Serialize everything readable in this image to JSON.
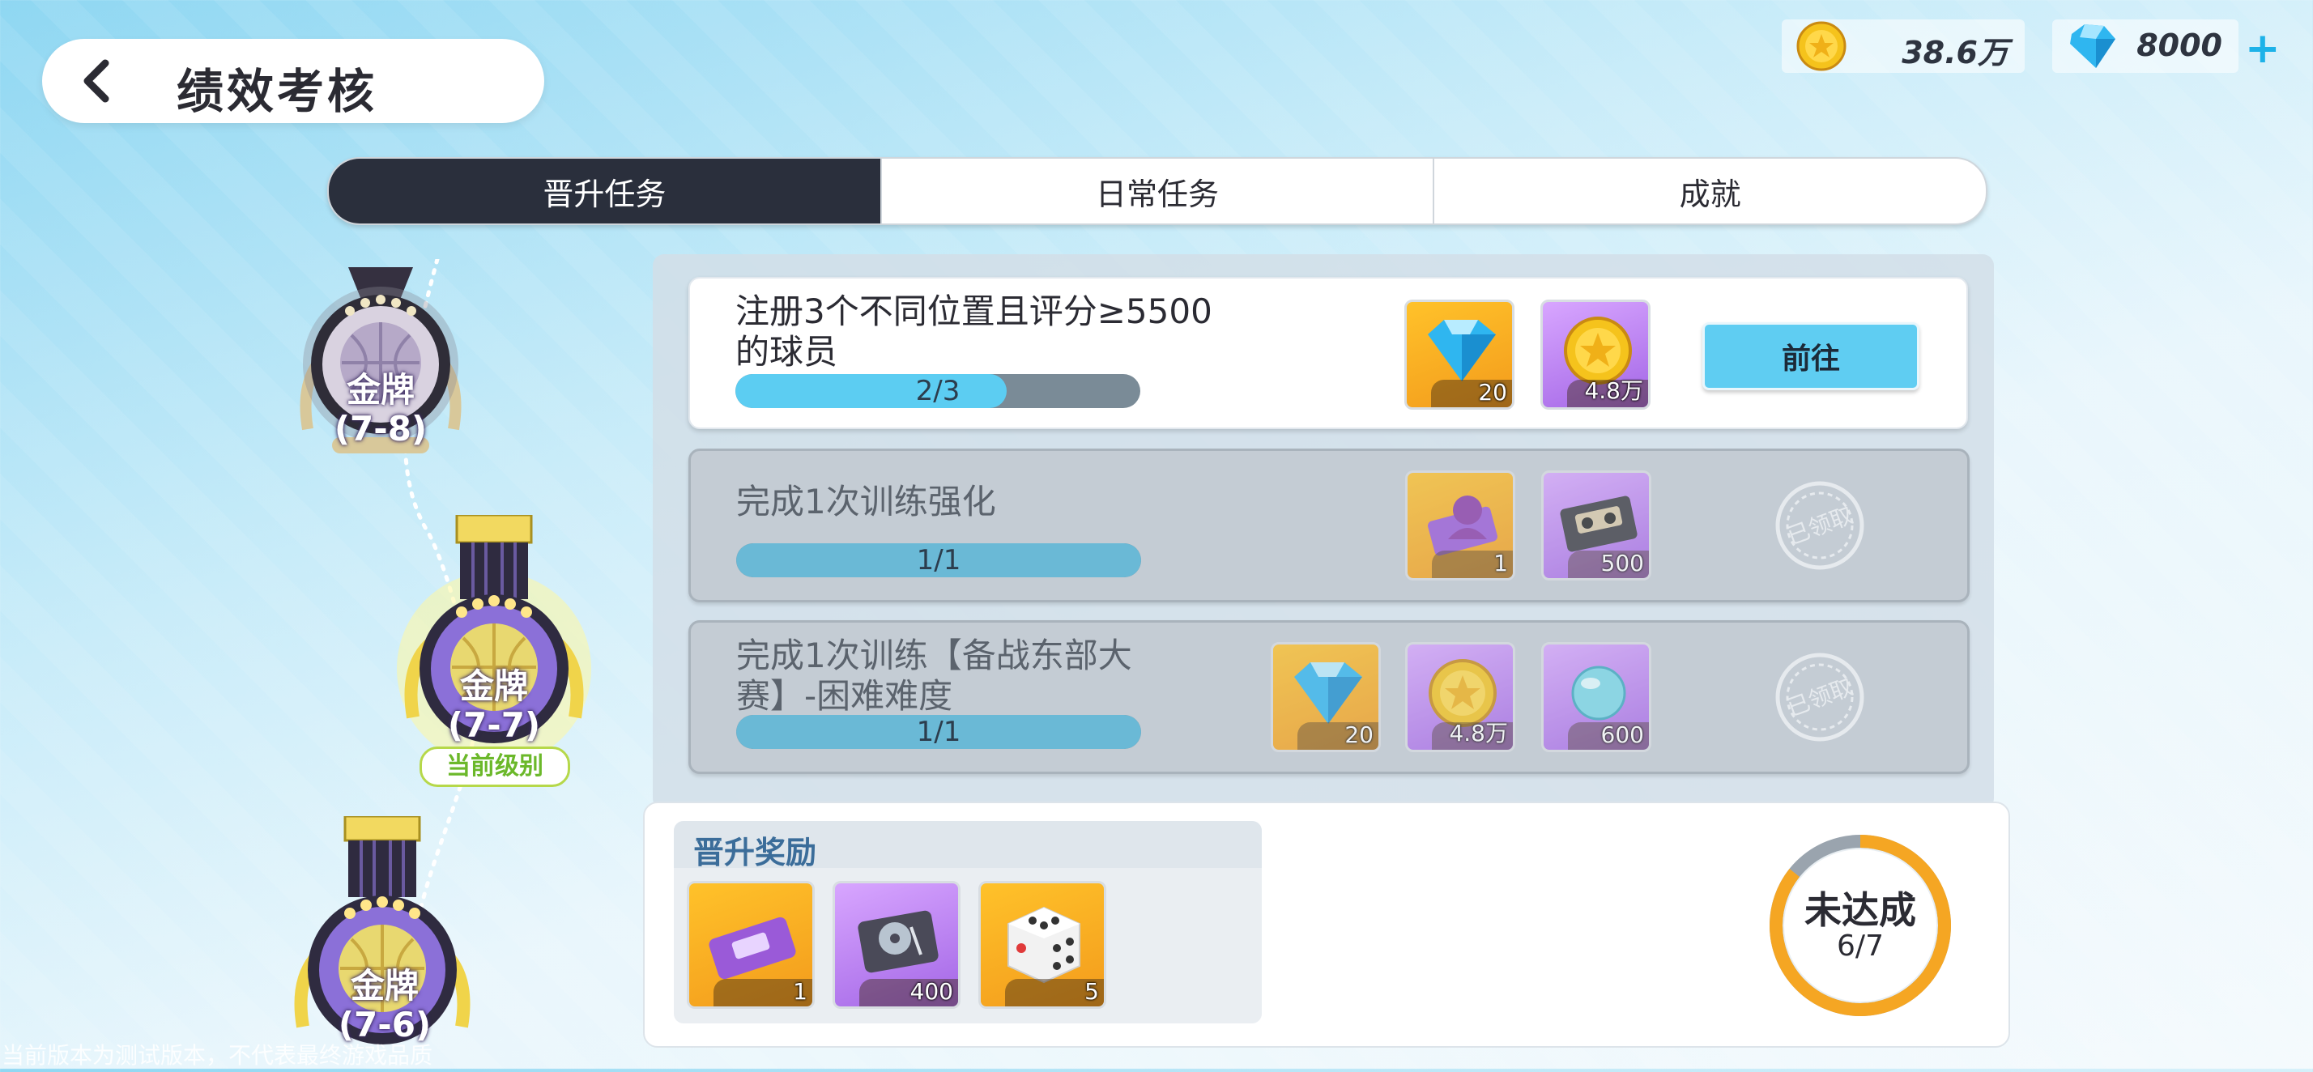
{
  "header": {
    "title": "绩效考核"
  },
  "resources": {
    "coins": "38.6万",
    "diamonds": "8000",
    "add": "+"
  },
  "tabs": [
    {
      "label": "晋升任务",
      "active": true
    },
    {
      "label": "日常任务",
      "active": false
    },
    {
      "label": "成就",
      "active": false
    }
  ],
  "medals": [
    {
      "name": "金牌",
      "level": "(7-8)"
    },
    {
      "name": "金牌",
      "level": "(7-7)"
    },
    {
      "name": "金牌",
      "level": "(7-6)"
    }
  ],
  "current_level_label": "当前级别",
  "tasks": [
    {
      "desc": "注册3个不同位置且评分≥5500的球员",
      "progress": "2/3",
      "progress_value": 0.67,
      "rewards": [
        {
          "icon": "diamond-icon",
          "count": "20"
        },
        {
          "icon": "coin-icon",
          "count": "4.8万"
        }
      ],
      "action": "前往",
      "state": "open"
    },
    {
      "desc": "完成1次训练强化",
      "progress": "1/1",
      "progress_value": 1.0,
      "rewards": [
        {
          "icon": "player-card-icon",
          "count": "1"
        },
        {
          "icon": "video-tape-icon",
          "count": "500"
        }
      ],
      "stamp": "已领取",
      "state": "claimed"
    },
    {
      "desc": "完成1次训练【备战东部大赛】-困难难度",
      "progress": "1/1",
      "progress_value": 1.0,
      "rewards": [
        {
          "icon": "diamond-icon",
          "count": "20"
        },
        {
          "icon": "coin-icon",
          "count": "4.8万"
        },
        {
          "icon": "orb-icon",
          "count": "600"
        }
      ],
      "stamp": "已领取",
      "state": "claimed"
    }
  ],
  "promotion": {
    "title": "晋升奖励",
    "rewards": [
      {
        "icon": "ticket-icon",
        "count": "1"
      },
      {
        "icon": "hard-drive-icon",
        "count": "400"
      },
      {
        "icon": "dice-icon",
        "count": "5"
      }
    ],
    "status": "未达成",
    "progress": "6/7",
    "progress_value": 0.857
  },
  "watermark": "当前版本为测试版本，不代表最终游戏品质",
  "colors": {
    "accent": "#5fcdf2",
    "tab_active": "#2a2f3c",
    "ring": "#f5a623"
  }
}
